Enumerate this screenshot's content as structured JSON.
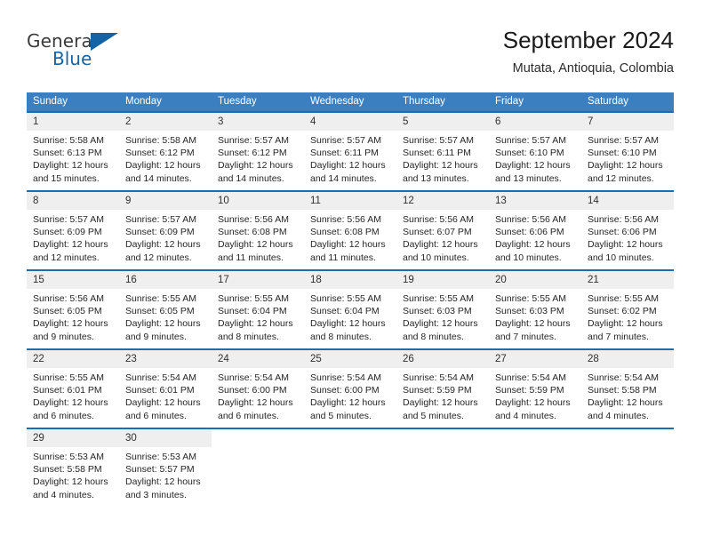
{
  "brand": {
    "name_part1": "General",
    "name_part2": "Blue",
    "flag_icon": "triangle-flag-icon"
  },
  "header": {
    "title": "September 2024",
    "location": "Mutata, Antioquia, Colombia"
  },
  "theme": {
    "header_blue": "#3c7fc0",
    "row_divider_blue": "#1d6cab",
    "daynum_band": "#efefef",
    "brand_blue": "#1464a5"
  },
  "weekday_headers": [
    "Sunday",
    "Monday",
    "Tuesday",
    "Wednesday",
    "Thursday",
    "Friday",
    "Saturday"
  ],
  "weeks": [
    [
      {
        "day": "1",
        "info": "Sunrise: 5:58 AM\nSunset: 6:13 PM\nDaylight: 12 hours\nand 15 minutes."
      },
      {
        "day": "2",
        "info": "Sunrise: 5:58 AM\nSunset: 6:12 PM\nDaylight: 12 hours\nand 14 minutes."
      },
      {
        "day": "3",
        "info": "Sunrise: 5:57 AM\nSunset: 6:12 PM\nDaylight: 12 hours\nand 14 minutes."
      },
      {
        "day": "4",
        "info": "Sunrise: 5:57 AM\nSunset: 6:11 PM\nDaylight: 12 hours\nand 14 minutes."
      },
      {
        "day": "5",
        "info": "Sunrise: 5:57 AM\nSunset: 6:11 PM\nDaylight: 12 hours\nand 13 minutes."
      },
      {
        "day": "6",
        "info": "Sunrise: 5:57 AM\nSunset: 6:10 PM\nDaylight: 12 hours\nand 13 minutes."
      },
      {
        "day": "7",
        "info": "Sunrise: 5:57 AM\nSunset: 6:10 PM\nDaylight: 12 hours\nand 12 minutes."
      }
    ],
    [
      {
        "day": "8",
        "info": "Sunrise: 5:57 AM\nSunset: 6:09 PM\nDaylight: 12 hours\nand 12 minutes."
      },
      {
        "day": "9",
        "info": "Sunrise: 5:57 AM\nSunset: 6:09 PM\nDaylight: 12 hours\nand 12 minutes."
      },
      {
        "day": "10",
        "info": "Sunrise: 5:56 AM\nSunset: 6:08 PM\nDaylight: 12 hours\nand 11 minutes."
      },
      {
        "day": "11",
        "info": "Sunrise: 5:56 AM\nSunset: 6:08 PM\nDaylight: 12 hours\nand 11 minutes."
      },
      {
        "day": "12",
        "info": "Sunrise: 5:56 AM\nSunset: 6:07 PM\nDaylight: 12 hours\nand 10 minutes."
      },
      {
        "day": "13",
        "info": "Sunrise: 5:56 AM\nSunset: 6:06 PM\nDaylight: 12 hours\nand 10 minutes."
      },
      {
        "day": "14",
        "info": "Sunrise: 5:56 AM\nSunset: 6:06 PM\nDaylight: 12 hours\nand 10 minutes."
      }
    ],
    [
      {
        "day": "15",
        "info": "Sunrise: 5:56 AM\nSunset: 6:05 PM\nDaylight: 12 hours\nand 9 minutes."
      },
      {
        "day": "16",
        "info": "Sunrise: 5:55 AM\nSunset: 6:05 PM\nDaylight: 12 hours\nand 9 minutes."
      },
      {
        "day": "17",
        "info": "Sunrise: 5:55 AM\nSunset: 6:04 PM\nDaylight: 12 hours\nand 8 minutes."
      },
      {
        "day": "18",
        "info": "Sunrise: 5:55 AM\nSunset: 6:04 PM\nDaylight: 12 hours\nand 8 minutes."
      },
      {
        "day": "19",
        "info": "Sunrise: 5:55 AM\nSunset: 6:03 PM\nDaylight: 12 hours\nand 8 minutes."
      },
      {
        "day": "20",
        "info": "Sunrise: 5:55 AM\nSunset: 6:03 PM\nDaylight: 12 hours\nand 7 minutes."
      },
      {
        "day": "21",
        "info": "Sunrise: 5:55 AM\nSunset: 6:02 PM\nDaylight: 12 hours\nand 7 minutes."
      }
    ],
    [
      {
        "day": "22",
        "info": "Sunrise: 5:55 AM\nSunset: 6:01 PM\nDaylight: 12 hours\nand 6 minutes."
      },
      {
        "day": "23",
        "info": "Sunrise: 5:54 AM\nSunset: 6:01 PM\nDaylight: 12 hours\nand 6 minutes."
      },
      {
        "day": "24",
        "info": "Sunrise: 5:54 AM\nSunset: 6:00 PM\nDaylight: 12 hours\nand 6 minutes."
      },
      {
        "day": "25",
        "info": "Sunrise: 5:54 AM\nSunset: 6:00 PM\nDaylight: 12 hours\nand 5 minutes."
      },
      {
        "day": "26",
        "info": "Sunrise: 5:54 AM\nSunset: 5:59 PM\nDaylight: 12 hours\nand 5 minutes."
      },
      {
        "day": "27",
        "info": "Sunrise: 5:54 AM\nSunset: 5:59 PM\nDaylight: 12 hours\nand 4 minutes."
      },
      {
        "day": "28",
        "info": "Sunrise: 5:54 AM\nSunset: 5:58 PM\nDaylight: 12 hours\nand 4 minutes."
      }
    ],
    [
      {
        "day": "29",
        "info": "Sunrise: 5:53 AM\nSunset: 5:58 PM\nDaylight: 12 hours\nand 4 minutes."
      },
      {
        "day": "30",
        "info": "Sunrise: 5:53 AM\nSunset: 5:57 PM\nDaylight: 12 hours\nand 3 minutes."
      },
      {
        "day": "",
        "info": ""
      },
      {
        "day": "",
        "info": ""
      },
      {
        "day": "",
        "info": ""
      },
      {
        "day": "",
        "info": ""
      },
      {
        "day": "",
        "info": ""
      }
    ]
  ]
}
